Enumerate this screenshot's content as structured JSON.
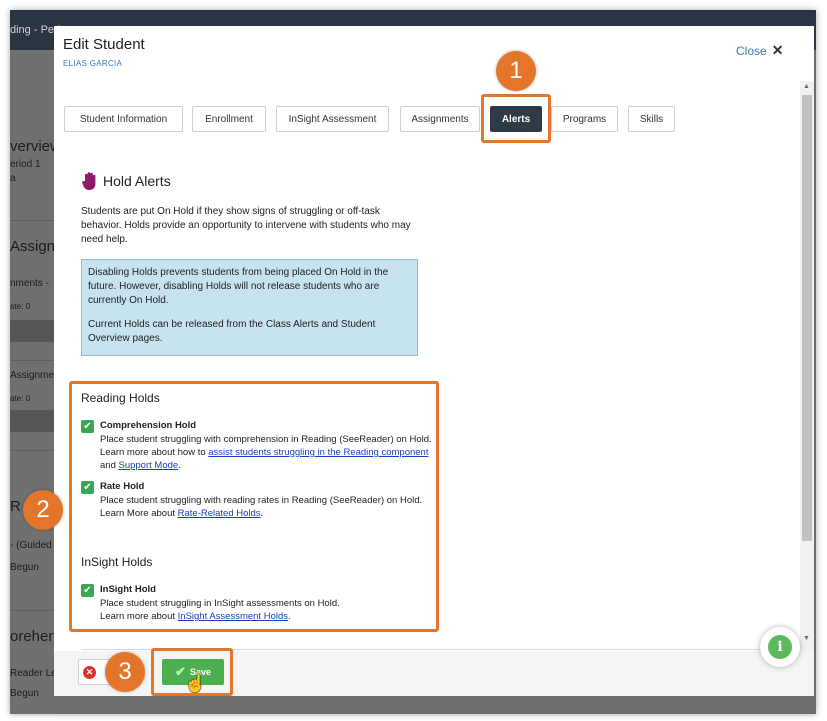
{
  "background": {
    "breadcrumb": "ding - Peri",
    "user": "",
    "texts": [
      "verview",
      "eriod 1",
      "a",
      "Assign",
      "nments -",
      "ate: 0",
      "Assignme",
      "ate: 0",
      "R",
      "- (Guided",
      "Begun",
      "orehens",
      "Reader Le",
      "Begun"
    ]
  },
  "modal": {
    "title": "Edit Student",
    "student_name": "ELIAS GARCIA",
    "close_label": "Close"
  },
  "tabs": [
    {
      "label": "Student Information"
    },
    {
      "label": "Enrollment"
    },
    {
      "label": "InSight Assessment"
    },
    {
      "label": "Assignments"
    },
    {
      "label": "Alerts"
    },
    {
      "label": "Programs"
    },
    {
      "label": "Skills"
    }
  ],
  "hold_alerts": {
    "title": "Hold Alerts",
    "description": "Students are put On Hold if they show signs of struggling or off-task behavior. Holds provide an opportunity to intervene with students who may need help.",
    "info_p1": "Disabling Holds prevents students from being placed On Hold in the future. However, disabling Holds will not release students who are currently On Hold.",
    "info_p2": "Current Holds can be released from the Class Alerts and Student Overview pages."
  },
  "reading_holds": {
    "title": "Reading Holds",
    "comprehension": {
      "title": "Comprehension Hold",
      "text_before": "Place student struggling with comprehension in Reading (SeeReader) on Hold. Learn more about how to ",
      "link1": "assist students struggling in the Reading component",
      "text_mid": " and ",
      "link2": "Support Mode",
      "text_after": "."
    },
    "rate": {
      "title": "Rate Hold",
      "text_before": "Place student struggling with reading rates in Reading (SeeReader) on Hold. Learn More about ",
      "link": "Rate-Related Holds",
      "text_after": "."
    }
  },
  "insight_holds": {
    "title": "InSight Holds",
    "insight": {
      "title": "InSight Hold",
      "text_before": "Place student struggling in InSight assessments on Hold.",
      "text_line2": "Learn more about ",
      "link": "InSight Assessment Holds",
      "text_after": "."
    }
  },
  "footer": {
    "save_label": "Save"
  },
  "annotations": {
    "badge1": "1",
    "badge2": "2",
    "badge3": "3",
    "color": "#e4762b"
  },
  "info_button": "i"
}
